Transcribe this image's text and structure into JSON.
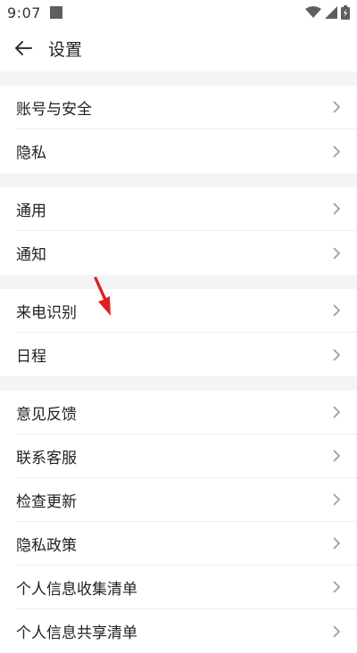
{
  "status_bar": {
    "time": "9:07"
  },
  "header": {
    "title": "设置"
  },
  "groups": [
    {
      "items": [
        {
          "label": "账号与安全"
        },
        {
          "label": "隐私"
        }
      ]
    },
    {
      "items": [
        {
          "label": "通用"
        },
        {
          "label": "通知"
        }
      ]
    },
    {
      "items": [
        {
          "label": "来电识别"
        },
        {
          "label": "日程"
        }
      ]
    },
    {
      "items": [
        {
          "label": "意见反馈"
        },
        {
          "label": "联系客服"
        },
        {
          "label": "检查更新"
        },
        {
          "label": "隐私政策"
        },
        {
          "label": "个人信息收集清单"
        },
        {
          "label": "个人信息共享清单"
        }
      ]
    }
  ],
  "colors": {
    "background": "#ffffff",
    "section_gap": "#f3f4f6",
    "annotation_arrow": "#e02020"
  },
  "icons": [
    "wifi-icon",
    "signal-icon",
    "battery-icon",
    "back-arrow-icon",
    "chevron-right-icon"
  ]
}
